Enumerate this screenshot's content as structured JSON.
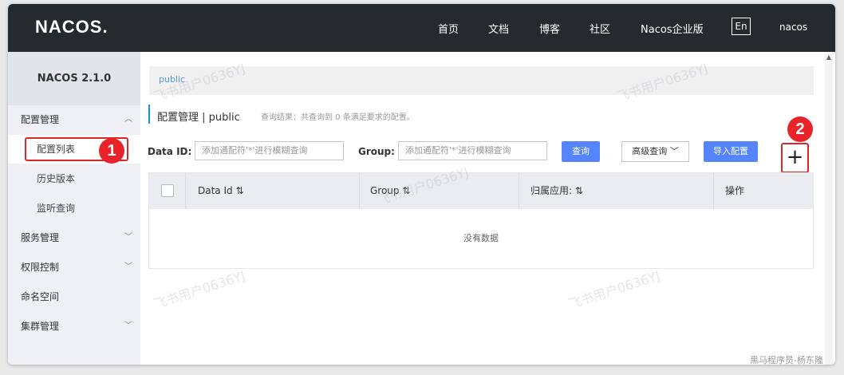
{
  "topbar": {
    "logo": "NACOS.",
    "nav": [
      "首页",
      "文档",
      "博客",
      "社区",
      "Nacos企业版"
    ],
    "lang": "En",
    "user": "nacos"
  },
  "sidebar": {
    "version": "NACOS 2.1.0",
    "items": [
      {
        "label": "配置管理",
        "chevron": "︿"
      },
      {
        "label": "配置列表"
      },
      {
        "label": "历史版本"
      },
      {
        "label": "监听查询"
      },
      {
        "label": "服务管理",
        "chevron": "﹀"
      },
      {
        "label": "权限控制",
        "chevron": "﹀"
      },
      {
        "label": "命名空间"
      },
      {
        "label": "集群管理",
        "chevron": "﹀"
      }
    ]
  },
  "breadcrumb": "public",
  "page": {
    "title": "配置管理  |  public",
    "subinfo": "查询结果：共查询到 0 条满足要求的配置。"
  },
  "filter": {
    "dataid_label": "Data ID:",
    "dataid_placeholder": "添加通配符'*'进行模糊查询",
    "group_label": "Group:",
    "group_placeholder": "添加通配符'*'进行模糊查询",
    "query_button": "查询",
    "advanced_button": "高级查询 ﹀",
    "import_button": "导入配置",
    "add_button": "+"
  },
  "annotations": {
    "badge1": "1",
    "badge2": "2"
  },
  "table": {
    "columns": [
      "Data Id ⇅",
      "Group ⇅",
      "归属应用: ⇅",
      "操作"
    ],
    "empty_text": "没有数据"
  },
  "watermark": "飞书用户0636YJ",
  "footer": "黑马程序员-杨东隆"
}
